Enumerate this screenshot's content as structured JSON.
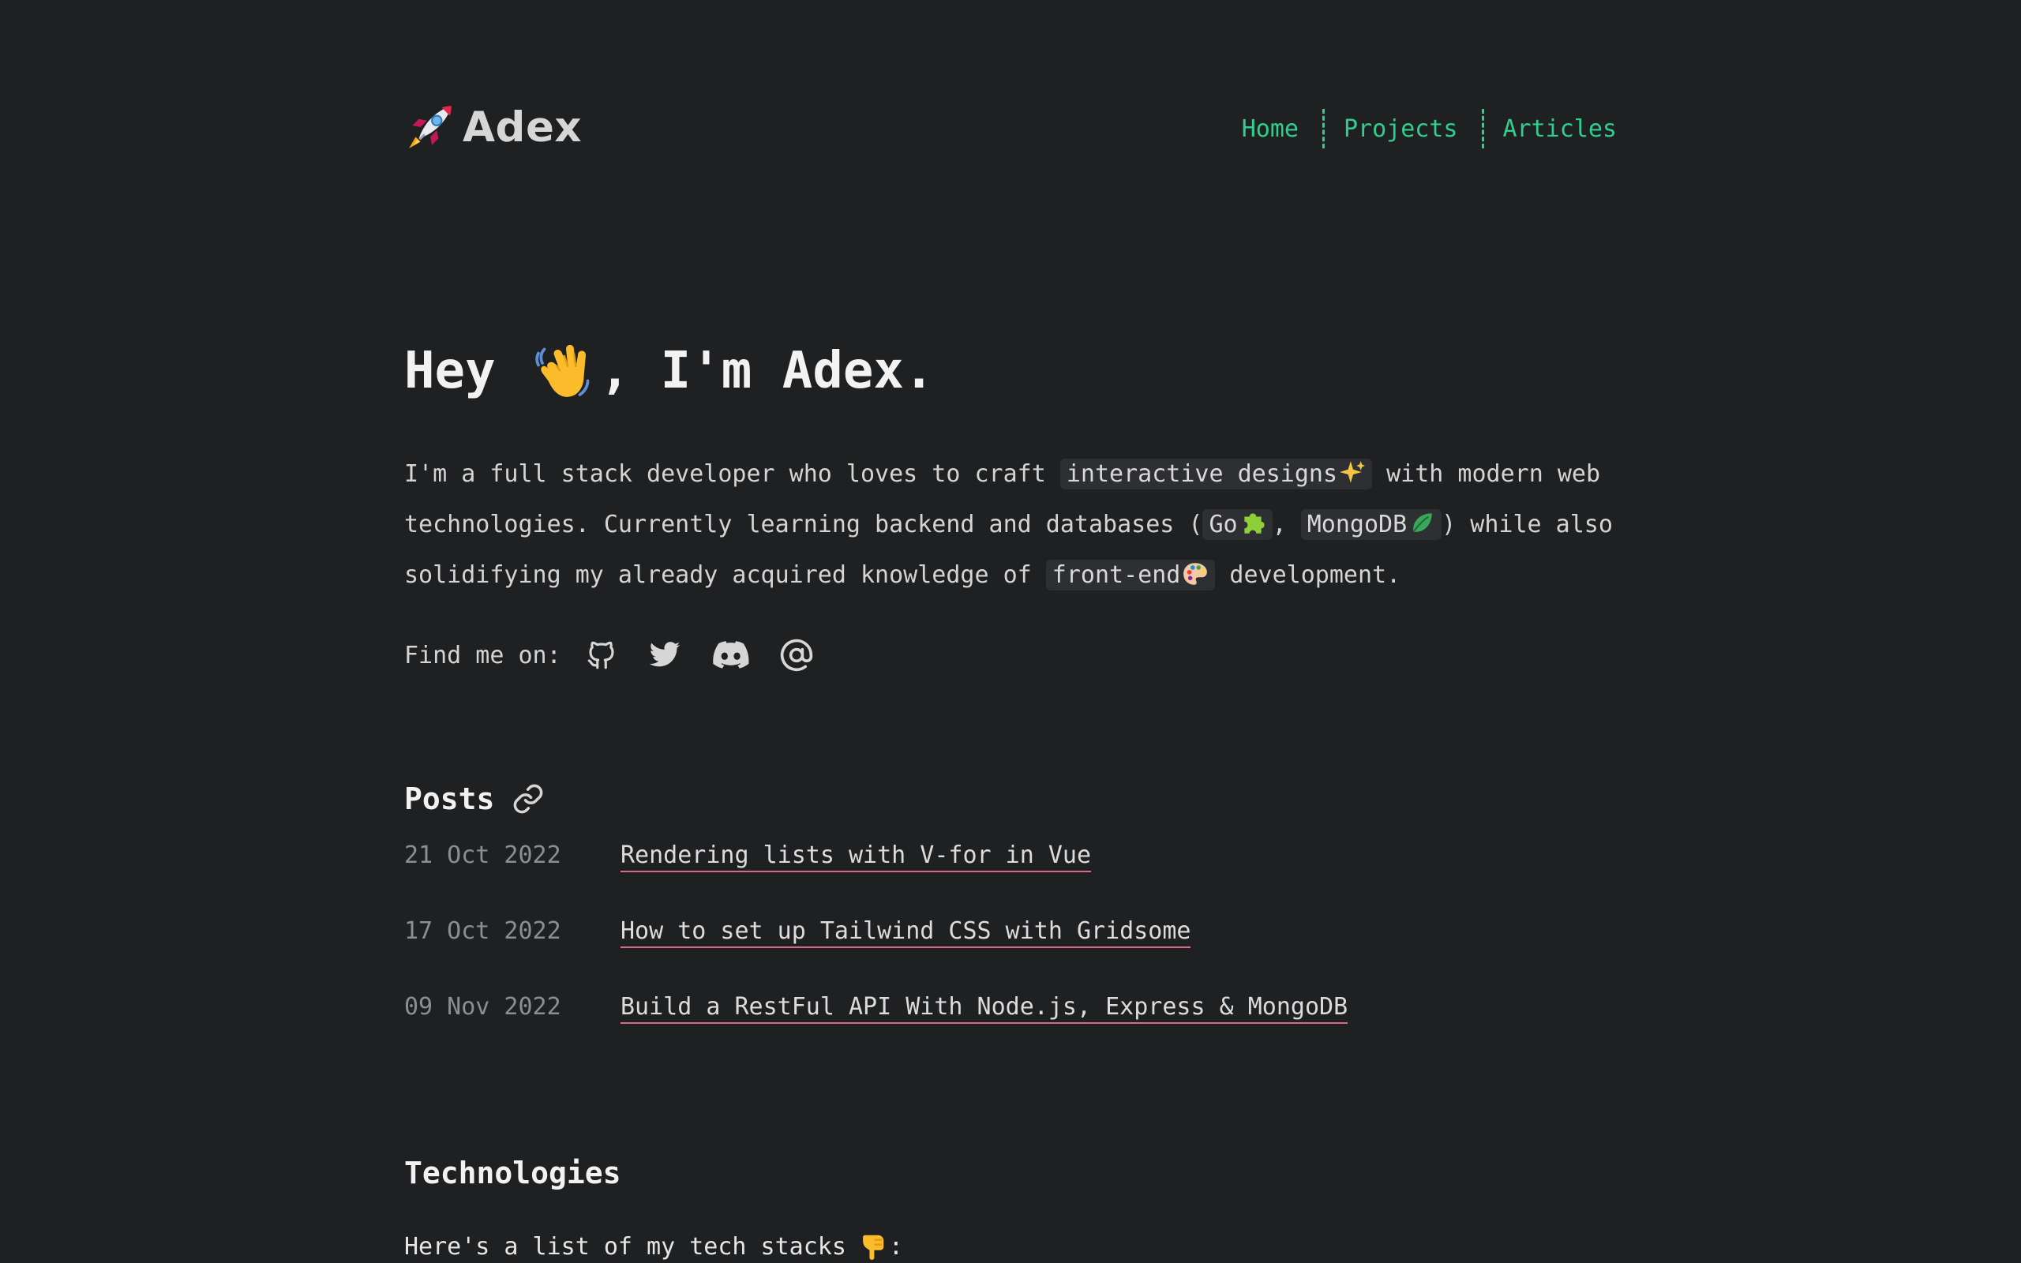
{
  "header": {
    "logo_icon": "rocket-icon",
    "brand": "Adex",
    "nav": [
      {
        "label": "Home"
      },
      {
        "label": "Projects"
      },
      {
        "label": "Articles"
      }
    ],
    "accent_color": "#2fcf8e"
  },
  "hero": {
    "title_before": "Hey",
    "title_icon": "waving-hand-icon",
    "title_after": ", I'm Adex.",
    "intro": {
      "t1": "I'm a full stack developer who loves to craft ",
      "code1": "interactive designs",
      "t2": " with modern web",
      "t3": "technologies. Currently learning backend and databases (",
      "code2": "Go",
      "t4": ", ",
      "code3": "MongoDB",
      "t5": ") while also",
      "t6": "solidifying my already acquired knowledge of ",
      "code4": "front-end",
      "t7": " development."
    },
    "find_me": "Find me on:",
    "social_icons": [
      "github-icon",
      "twitter-icon",
      "discord-icon",
      "email-at-icon"
    ]
  },
  "posts": {
    "heading": "Posts",
    "heading_icon": "link-icon",
    "items": [
      {
        "date": "21 Oct 2022",
        "title": "Rendering lists with V-for in Vue"
      },
      {
        "date": "17 Oct 2022",
        "title": "How to set up Tailwind CSS with Gridsome"
      },
      {
        "date": "09 Nov 2022",
        "title": "Build a RestFul API With Node.js, Express & MongoDB"
      }
    ],
    "underline_color": "#d96a8c"
  },
  "technologies": {
    "heading": "Technologies",
    "intro": "Here's a list of my tech stacks",
    "intro_icon": "pointing-down-icon",
    "intro_suffix": ":"
  }
}
